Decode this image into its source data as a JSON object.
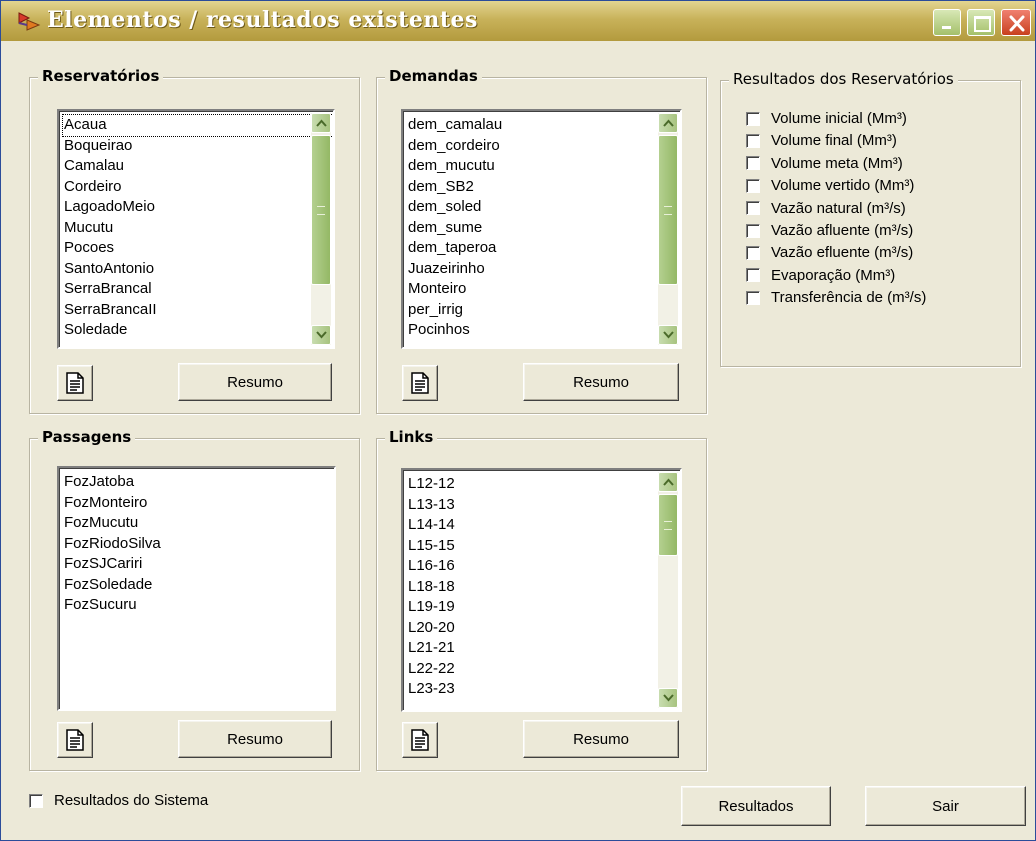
{
  "window": {
    "title": "Elementos / resultados existentes",
    "icon": "app-arrows-icon",
    "controls": [
      "minimize-icon",
      "maximize-icon",
      "close-icon"
    ]
  },
  "reservatorios": {
    "label": "Reservatórios",
    "items": [
      "Acaua",
      "Boqueirao",
      "Camalau",
      "Cordeiro",
      "LagoadoMeio",
      "Mucutu",
      "Pocoes",
      "SantoAntonio",
      "SerraBrancal",
      "SerraBrancaII",
      "Soledade"
    ],
    "selected": "Acaua",
    "resumo_label": "Resumo"
  },
  "demandas": {
    "label": "Demandas",
    "items": [
      "dem_camalau",
      "dem_cordeiro",
      "dem_mucutu",
      "dem_SB2",
      "dem_soled",
      "dem_sume",
      "dem_taperoa",
      "Juazeirinho",
      "Monteiro",
      "per_irrig",
      "Pocinhos"
    ],
    "resumo_label": "Resumo"
  },
  "passagens": {
    "label": "Passagens",
    "items": [
      "FozJatoba",
      "FozMonteiro",
      "FozMucutu",
      "FozRiodoSilva",
      "FozSJCariri",
      "FozSoledade",
      "FozSucuru"
    ],
    "resumo_label": "Resumo"
  },
  "links": {
    "label": "Links",
    "items": [
      "L12-12",
      "L13-13",
      "L14-14",
      "L15-15",
      "L16-16",
      "L18-18",
      "L19-19",
      "L20-20",
      "L21-21",
      "L22-22",
      "L23-23"
    ],
    "resumo_label": "Resumo"
  },
  "resultados_reservatorios": {
    "label": "Resultados dos Reservatórios",
    "options": [
      {
        "label": "Volume inicial (Mm³)",
        "checked": false
      },
      {
        "label": "Volume final (Mm³)",
        "checked": false
      },
      {
        "label": "Volume meta (Mm³)",
        "checked": false
      },
      {
        "label": "Volume vertido (Mm³)",
        "checked": false
      },
      {
        "label": "Vazão natural (m³/s)",
        "checked": false
      },
      {
        "label": "Vazão afluente (m³/s)",
        "checked": false
      },
      {
        "label": "Vazão efluente (m³/s)",
        "checked": false
      },
      {
        "label": "Evaporação (Mm³)",
        "checked": false
      },
      {
        "label": "Transferência de (m³/s)",
        "checked": false
      }
    ]
  },
  "footer": {
    "resultados_sistema_label": "Resultados do Sistema",
    "resultados_sistema_checked": false,
    "resultados_button": "Resultados",
    "sair_button": "Sair"
  }
}
